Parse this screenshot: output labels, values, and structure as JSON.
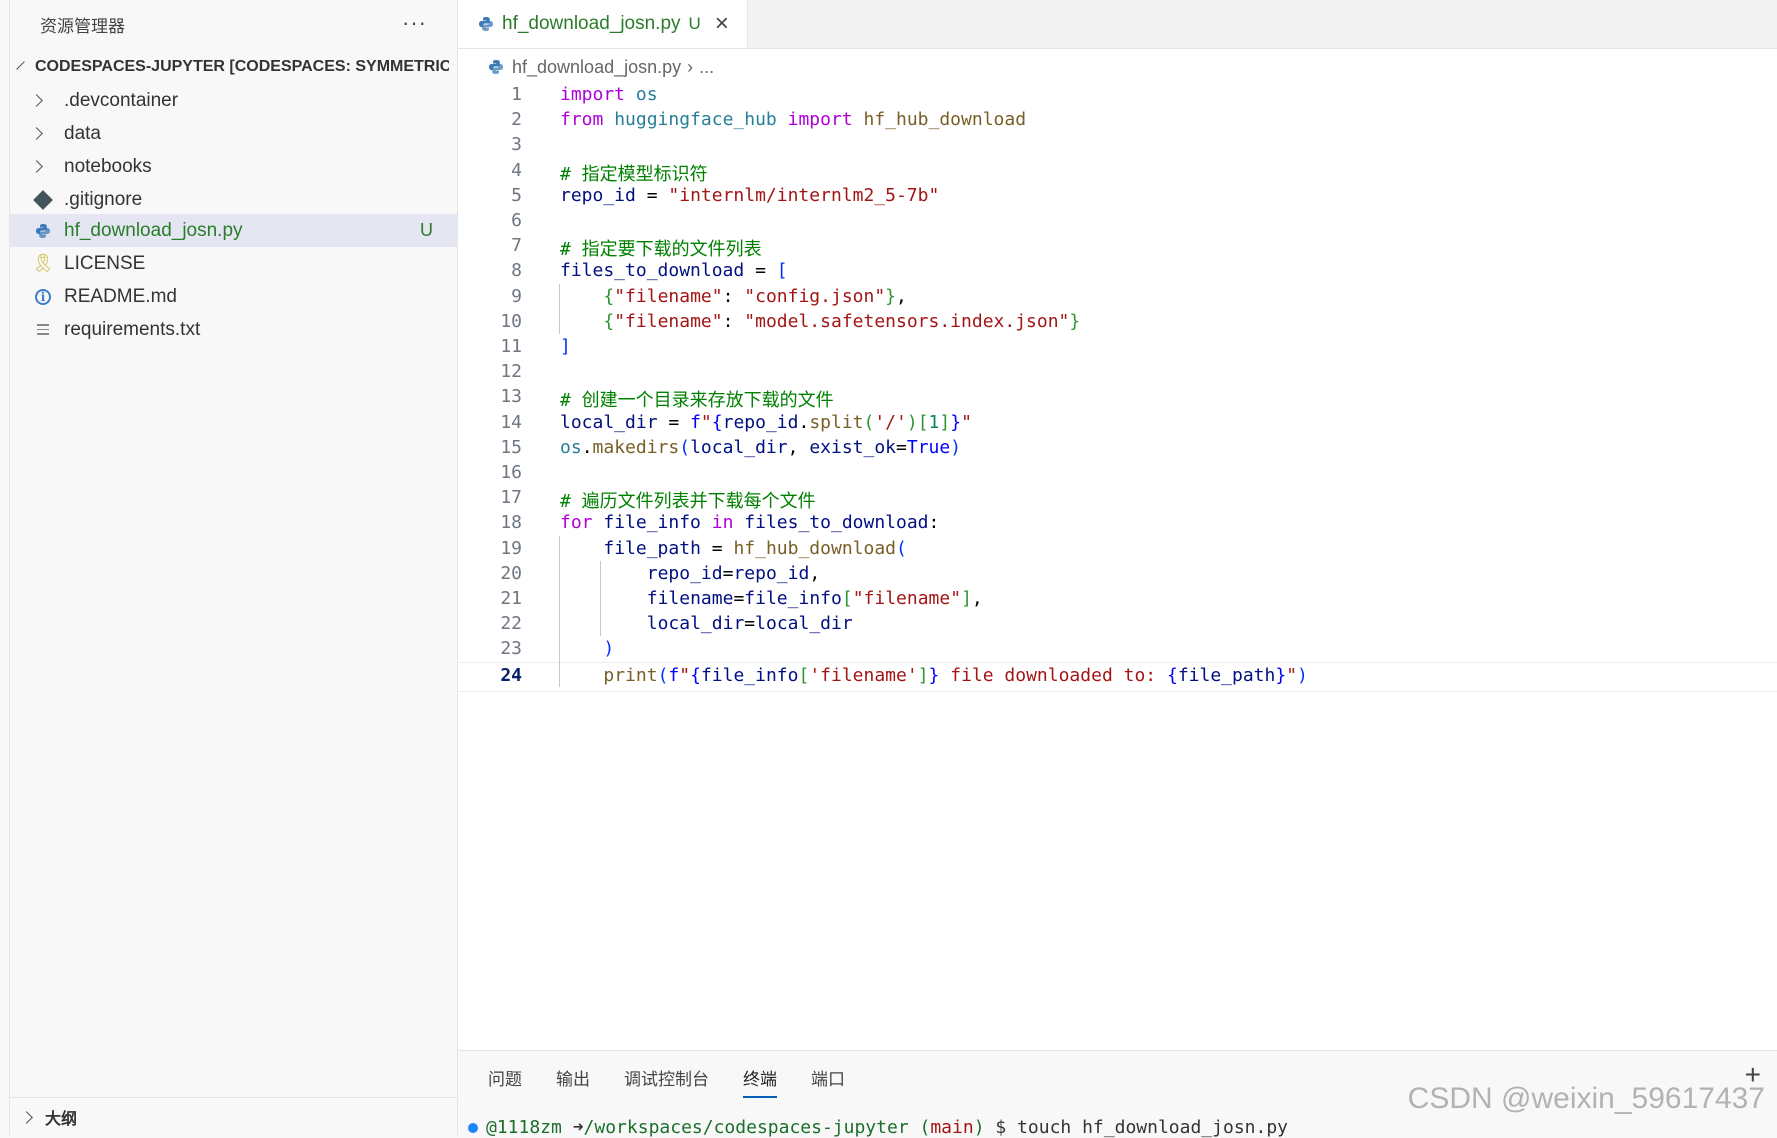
{
  "sidebar": {
    "title": "资源管理器",
    "more": "···",
    "root": "CODESPACES-JUPYTER [CODESPACES: SYMMETRIC...",
    "items": [
      {
        "label": ".devcontainer",
        "type": "folder"
      },
      {
        "label": "data",
        "type": "folder"
      },
      {
        "label": "notebooks",
        "type": "folder"
      },
      {
        "label": ".gitignore",
        "type": "git"
      },
      {
        "label": "hf_download_josn.py",
        "type": "python",
        "badge": "U",
        "selected": true
      },
      {
        "label": "LICENSE",
        "type": "license"
      },
      {
        "label": "README.md",
        "type": "info"
      },
      {
        "label": "requirements.txt",
        "type": "text"
      }
    ],
    "outline": "大纲"
  },
  "editor": {
    "tab": {
      "label": "hf_download_josn.py",
      "status": "U",
      "close": "×"
    },
    "breadcrumb": {
      "file": "hf_download_josn.py",
      "more": "..."
    },
    "active_line": 24,
    "lines": [
      "import os",
      "from huggingface_hub import hf_hub_download",
      "",
      "# 指定模型标识符",
      "repo_id = \"internlm/internlm2_5-7b\"",
      "",
      "# 指定要下载的文件列表",
      "files_to_download = [",
      "    {\"filename\": \"config.json\"},",
      "    {\"filename\": \"model.safetensors.index.json\"}",
      "]",
      "",
      "# 创建一个目录来存放下载的文件",
      "local_dir = f\"{repo_id.split('/')[1]}\"",
      "os.makedirs(local_dir, exist_ok=True)",
      "",
      "# 遍历文件列表并下载每个文件",
      "for file_info in files_to_download:",
      "    file_path = hf_hub_download(",
      "        repo_id=repo_id,",
      "        filename=file_info[\"filename\"],",
      "        local_dir=local_dir",
      "    )",
      "    print(f\"{file_info['filename']} file downloaded to: {file_path}\")"
    ]
  },
  "panel": {
    "tabs": [
      "问题",
      "输出",
      "调试控制台",
      "终端",
      "端口"
    ],
    "active_tab": "终端",
    "plus": "+",
    "terminal": {
      "user": "@1118zm",
      "arrow": "➜",
      "path": "/workspaces/codespaces-jupyter",
      "branch_open": "(",
      "branch": "main",
      "branch_close": ")",
      "prompt": "$",
      "command": "touch hf_download_josn.py"
    }
  },
  "watermark": "CSDN @weixin_59617437",
  "colors": {
    "keyword": "#af00db",
    "control": "#0000ff",
    "string": "#a31515",
    "comment": "#008000",
    "function": "#795e26",
    "variable": "#001080",
    "module": "#267f99",
    "untracked": "#2a7d2a",
    "selection": "#e4e6f1"
  }
}
